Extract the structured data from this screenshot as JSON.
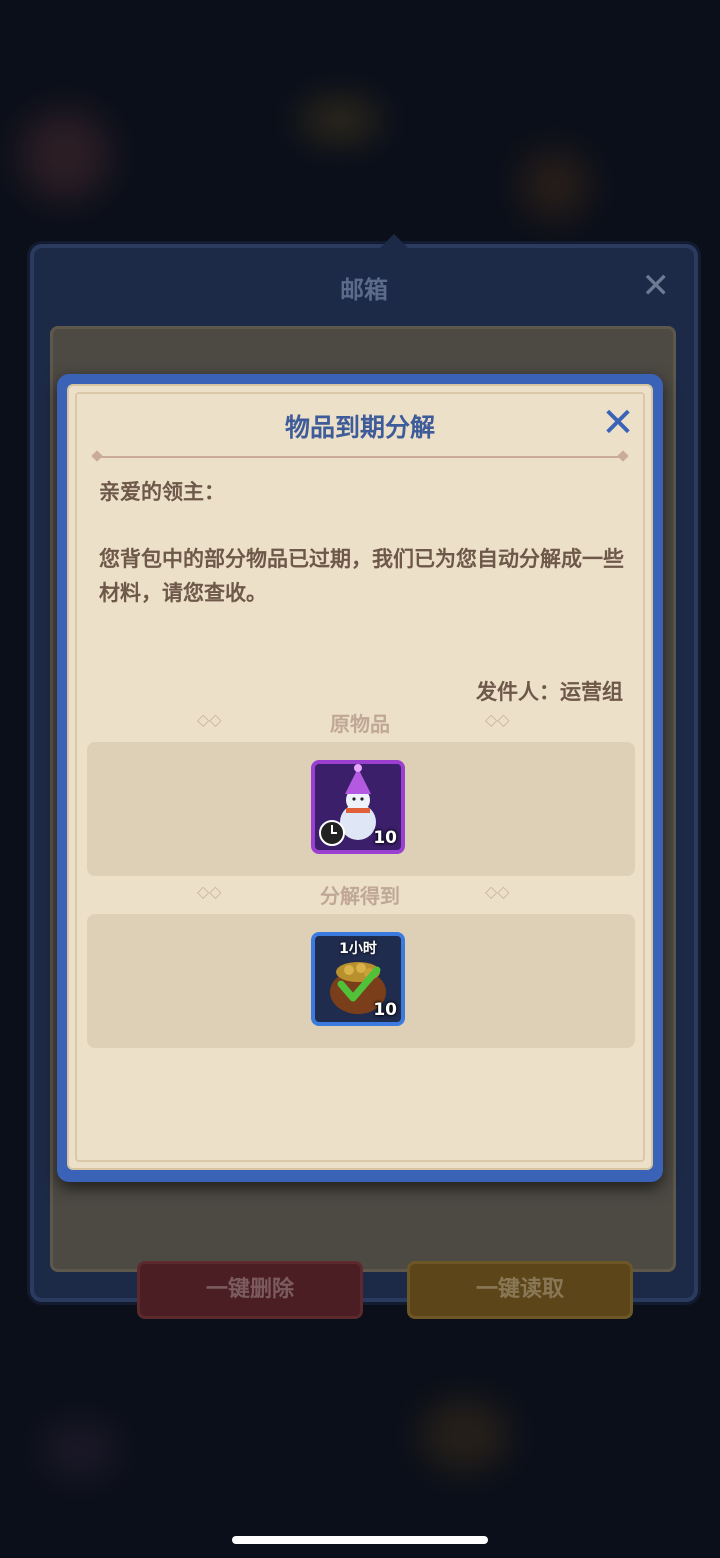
{
  "mailbox": {
    "title": "邮箱",
    "delete_all_label": "一键删除",
    "read_all_label": "一键读取"
  },
  "dialog": {
    "title": "物品到期分解",
    "greeting": "亲爱的领主：",
    "body": "您背包中的部分物品已过期，我们已为您自动分解成一些材料，请您查收。",
    "sender": "发件人：运营组",
    "original_section_label": "原物品",
    "result_section_label": "分解得到",
    "original_item": {
      "icon": "snowman-icon",
      "quantity": "10",
      "expiring": true
    },
    "result_item": {
      "icon": "coin-bag-icon",
      "quantity": "10",
      "time_tag": "1小时"
    }
  },
  "colors": {
    "accent": "#3a63b8",
    "parchment": "#ece0c8",
    "text": "#6e5849"
  }
}
